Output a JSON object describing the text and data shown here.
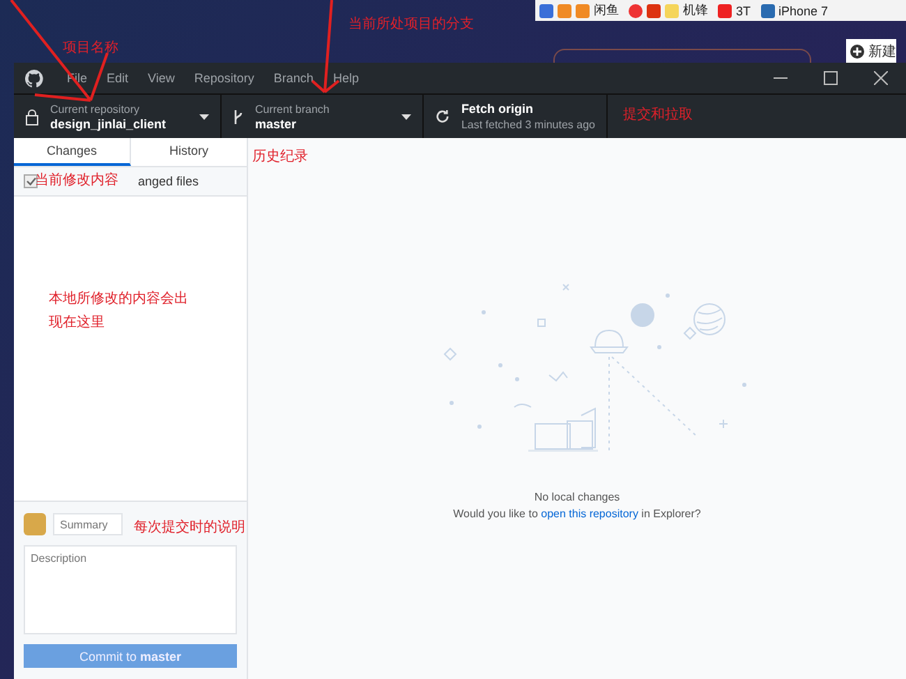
{
  "browser_bookmarks": [
    "闲鱼",
    "机锋",
    "3T",
    "iPhone 7"
  ],
  "browser_button": "新建",
  "window": {
    "menu": [
      "File",
      "Edit",
      "View",
      "Repository",
      "Branch",
      "Help"
    ]
  },
  "toolbar": [
    {
      "kind": "repository",
      "caption": "Current repository",
      "value": "design_jinlai_client"
    },
    {
      "kind": "branch",
      "caption": "Current branch",
      "value": "master"
    },
    {
      "kind": "fetch",
      "caption": "Fetch origin",
      "value": "Last fetched 3 minutes ago"
    }
  ],
  "tabs": [
    {
      "label": "Changes",
      "selected": true
    },
    {
      "label": "History",
      "selected": false
    }
  ],
  "changes": {
    "checked": true,
    "label": "anged files"
  },
  "commit": {
    "summary_placeholder": "Summary",
    "description_placeholder": "Description",
    "button": "Commit to **master**"
  },
  "empty_state": {
    "title": "No local changes",
    "before": "Would you like to ",
    "link": "open this repository",
    "after": " in Explorer?"
  },
  "annotations": [
    {
      "kind": "repo",
      "text": "项目名称"
    },
    {
      "kind": "branch",
      "text": "当前所处项目的分支"
    },
    {
      "kind": "fetch",
      "text": "提交和拉取"
    },
    {
      "kind": "history",
      "text": "历史纪录"
    },
    {
      "kind": "changes",
      "text": "当前修改内容"
    },
    {
      "kind": "list",
      "text": "本地所修改的内容会出现在这里"
    },
    {
      "kind": "summary",
      "text": "每次提交时的说明"
    }
  ]
}
